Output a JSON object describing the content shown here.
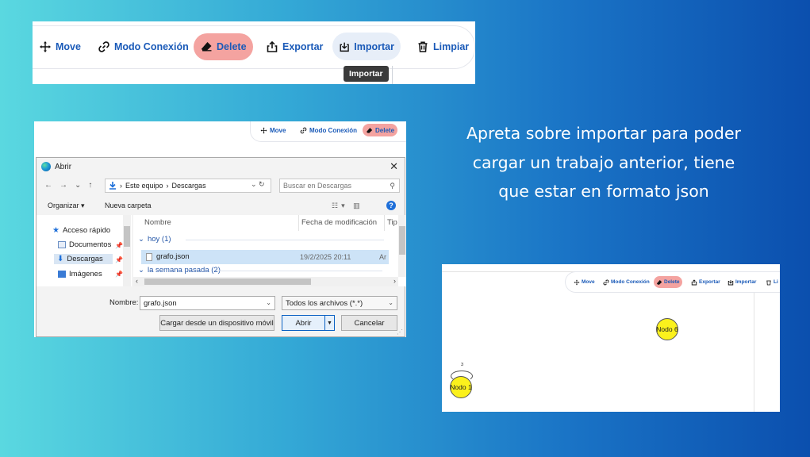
{
  "toolbar": {
    "move": "Move",
    "modo_conexion": "Modo Conexión",
    "delete": "Delete",
    "exportar": "Exportar",
    "importar": "Importar",
    "limpiar": "Limpiar",
    "tooltip": "Importar",
    "accent_color": "#1a5ab8",
    "delete_bg": "#f4a3a0"
  },
  "dialog": {
    "title": "Abrir",
    "close": "✕",
    "path": [
      "Este equipo",
      "Descargas"
    ],
    "search_placeholder": "Buscar en Descargas",
    "organize": "Organizar ▾",
    "new_folder": "Nueva carpeta",
    "sidebar": [
      {
        "label": "Acceso rápido",
        "icon": "star-icon"
      },
      {
        "label": "Documentos",
        "icon": "document-icon"
      },
      {
        "label": "Descargas",
        "icon": "download-icon"
      },
      {
        "label": "Imágenes",
        "icon": "image-icon"
      }
    ],
    "columns": [
      "Nombre",
      "Fecha de modificación",
      "Tip"
    ],
    "groups": {
      "today": "hoy (1)",
      "last_week": "la semana pasada (2)"
    },
    "file": {
      "name": "grafo.json",
      "date": "19/2/2025 20:11",
      "type": "Ar"
    },
    "name_label": "Nombre:",
    "name_value": "grafo.json",
    "file_type": "Todos los archivos (*.*)",
    "mobile_button": "Cargar desde un dispositivo móvil",
    "open_button": "Abrir",
    "cancel_button": "Cancelar"
  },
  "instruction": "Apreta sobre importar para poder cargar un trabajo anterior, tiene que estar en formato json",
  "canvas": {
    "toolbar": {
      "move": "Move",
      "modo_conexion": "Modo Conexión",
      "delete": "Delete",
      "exportar": "Exportar",
      "importar": "Importar",
      "limpiar": "Li"
    },
    "nodes": [
      {
        "label": "Nodo 6",
        "color": "#fbf11c"
      },
      {
        "label": "Nodo 1",
        "color": "#fbf11c"
      }
    ],
    "loop_label": "3"
  }
}
